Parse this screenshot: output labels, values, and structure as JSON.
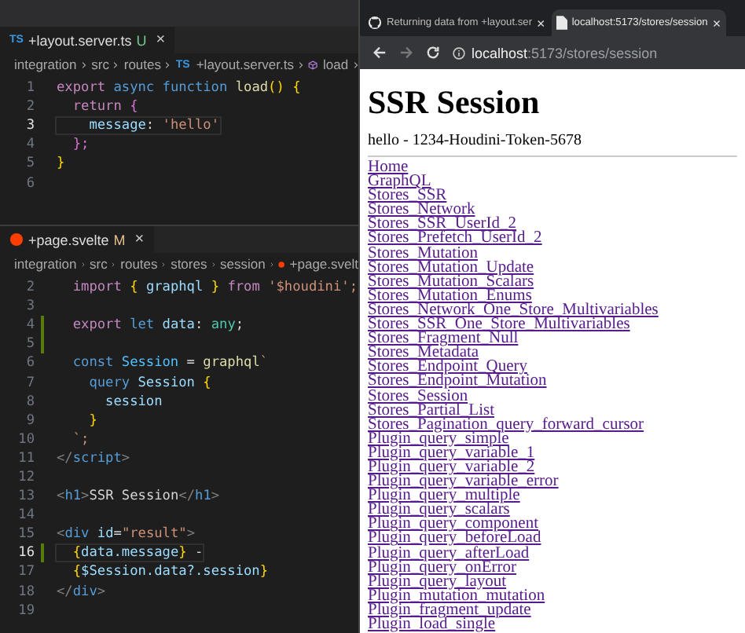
{
  "editor": {
    "panes": [
      {
        "tab": {
          "badge": "TS",
          "filename": "+layout.server.ts",
          "status": "U",
          "close": "×"
        },
        "breadcrumb": [
          {
            "kind": "text",
            "label": "integration"
          },
          {
            "kind": "text",
            "label": "src"
          },
          {
            "kind": "text",
            "label": "routes"
          },
          {
            "kind": "ts",
            "badge": "TS",
            "label": "+layout.server.ts"
          },
          {
            "kind": "symbol",
            "label": "load"
          }
        ],
        "trailing_chevron": true,
        "lines": [
          {
            "number": "1",
            "current": false,
            "changed": false,
            "tokens": [
              {
                "text": "export ",
                "kind": "kw"
              },
              {
                "text": "async ",
                "kind": "kw2"
              },
              {
                "text": "function ",
                "kind": "kw2"
              },
              {
                "text": "load",
                "kind": "fn"
              },
              {
                "text": "() {",
                "kind": "brace"
              }
            ]
          },
          {
            "number": "2",
            "current": false,
            "changed": false,
            "tokens": [
              {
                "text": "  return ",
                "kind": "kw"
              },
              {
                "text": "{",
                "kind": "brace2"
              }
            ]
          },
          {
            "number": "3",
            "current": true,
            "changed": false,
            "tokens": [
              {
                "text": "    message",
                "kind": "prop"
              },
              {
                "text": ": ",
                "kind": "txt"
              },
              {
                "text": "'hello'",
                "kind": "str"
              }
            ]
          },
          {
            "number": "4",
            "current": false,
            "changed": false,
            "tokens": [
              {
                "text": "  };",
                "kind": "brace2"
              }
            ]
          },
          {
            "number": "5",
            "current": false,
            "changed": false,
            "tokens": [
              {
                "text": "}",
                "kind": "brace"
              }
            ]
          },
          {
            "number": "6",
            "current": false,
            "changed": false
          }
        ]
      },
      {
        "tab": {
          "filename": "+page.svelte",
          "status": "M",
          "close": "×"
        },
        "breadcrumb": [
          {
            "kind": "text",
            "label": "integration"
          },
          {
            "kind": "text",
            "label": "src"
          },
          {
            "kind": "text",
            "label": "routes"
          },
          {
            "kind": "text",
            "label": "stores"
          },
          {
            "kind": "text",
            "label": "session"
          },
          {
            "kind": "svelte",
            "label": "+page.svelt"
          }
        ],
        "trailing_chevron": false,
        "lines": [
          {
            "number": "2",
            "current": false,
            "changed": false,
            "tokens": [
              {
                "text": "  import ",
                "kind": "kw"
              },
              {
                "text": "{",
                "kind": "brace"
              },
              {
                "text": " graphql ",
                "kind": "prop"
              },
              {
                "text": "} ",
                "kind": "brace"
              },
              {
                "text": "from ",
                "kind": "kw"
              },
              {
                "text": "'$houdini';",
                "kind": "str"
              }
            ]
          },
          {
            "number": "3",
            "current": false,
            "changed": false
          },
          {
            "number": "4",
            "current": false,
            "changed": true,
            "tokens": [
              {
                "text": "  export ",
                "kind": "kw"
              },
              {
                "text": "let",
                "kind": "kw2"
              },
              {
                "text": " data",
                "kind": "prop"
              },
              {
                "text": ": ",
                "kind": "txt"
              },
              {
                "text": "any",
                "kind": "type"
              },
              {
                "text": ";",
                "kind": "txt"
              }
            ]
          },
          {
            "number": "5",
            "current": false,
            "changed": true
          },
          {
            "number": "6",
            "current": false,
            "changed": false,
            "tokens": [
              {
                "text": "  const",
                "kind": "kw2"
              },
              {
                "text": " Session",
                "kind": "var"
              },
              {
                "text": " = ",
                "kind": "txt"
              },
              {
                "text": "graphql",
                "kind": "fn"
              },
              {
                "text": "`",
                "kind": "str"
              }
            ]
          },
          {
            "number": "7",
            "current": false,
            "changed": false,
            "tokens": [
              {
                "text": "    query",
                "kind": "kw2"
              },
              {
                "text": " Session ",
                "kind": "prop"
              },
              {
                "text": "{",
                "kind": "brace"
              }
            ]
          },
          {
            "number": "8",
            "current": false,
            "changed": false,
            "tokens": [
              {
                "text": "      session",
                "kind": "prop"
              }
            ]
          },
          {
            "number": "9",
            "current": false,
            "changed": false,
            "tokens": [
              {
                "text": "    }",
                "kind": "brace"
              }
            ]
          },
          {
            "number": "10",
            "current": false,
            "changed": false,
            "tokens": [
              {
                "text": "  `;",
                "kind": "str"
              }
            ]
          },
          {
            "number": "11",
            "current": false,
            "changed": false,
            "tokens": [
              {
                "text": "</",
                "kind": "tag"
              },
              {
                "text": "script",
                "kind": "tagname"
              },
              {
                "text": ">",
                "kind": "tag"
              }
            ]
          },
          {
            "number": "12",
            "current": false,
            "changed": false
          },
          {
            "number": "13",
            "current": false,
            "changed": false,
            "tokens": [
              {
                "text": "<",
                "kind": "tag"
              },
              {
                "text": "h1",
                "kind": "tagname"
              },
              {
                "text": ">",
                "kind": "tag"
              },
              {
                "text": "SSR Session",
                "kind": "txt"
              },
              {
                "text": "</",
                "kind": "tag"
              },
              {
                "text": "h1",
                "kind": "tagname"
              },
              {
                "text": ">",
                "kind": "tag"
              }
            ]
          },
          {
            "number": "14",
            "current": false,
            "changed": false
          },
          {
            "number": "15",
            "current": false,
            "changed": false,
            "tokens": [
              {
                "text": "<",
                "kind": "tag"
              },
              {
                "text": "div",
                "kind": "tagname"
              },
              {
                "text": " id",
                "kind": "prop"
              },
              {
                "text": "=",
                "kind": "txt"
              },
              {
                "text": "\"result\"",
                "kind": "str"
              },
              {
                "text": ">",
                "kind": "tag"
              }
            ]
          },
          {
            "number": "16",
            "current": true,
            "changed": true,
            "tokens": [
              {
                "text": "  {",
                "kind": "brace"
              },
              {
                "text": "data.message",
                "kind": "prop"
              },
              {
                "text": "}",
                "kind": "brace"
              },
              {
                "text": " -",
                "kind": "txt"
              }
            ]
          },
          {
            "number": "17",
            "current": false,
            "changed": false,
            "tokens": [
              {
                "text": "  {",
                "kind": "brace"
              },
              {
                "text": "$Session.data?.session",
                "kind": "prop"
              },
              {
                "text": "}",
                "kind": "brace"
              }
            ]
          },
          {
            "number": "18",
            "current": false,
            "changed": false,
            "tokens": [
              {
                "text": "</",
                "kind": "tag"
              },
              {
                "text": "div",
                "kind": "tagname"
              },
              {
                "text": ">",
                "kind": "tag"
              }
            ]
          },
          {
            "number": "19",
            "current": false,
            "changed": false
          }
        ]
      }
    ]
  },
  "browser": {
    "tabs": [
      {
        "kind": "github",
        "title": "Returning data from +layout.ser",
        "close": "×",
        "selected": false
      },
      {
        "kind": "page",
        "title": "localhost:5173/stores/session",
        "close": "×",
        "selected": true
      }
    ],
    "address": {
      "host": "localhost",
      "path": ":5173/stores/session"
    },
    "page": {
      "heading": "SSR Session",
      "result": "hello - 1234-Houdini-Token-5678",
      "links": [
        "Home",
        "GraphQL",
        "Stores_SSR",
        "Stores_Network",
        "Stores_SSR_UserId_2",
        "Stores_Prefetch_UserId_2",
        "Stores_Mutation",
        "Stores_Mutation_Update",
        "Stores_Mutation_Scalars",
        "Stores_Mutation_Enums",
        "Stores_Network_One_Store_Multivariables",
        "Stores_SSR_One_Store_Multivariables",
        "Stores_Fragment_Null",
        "Stores_Metadata",
        "Stores_Endpoint_Query",
        "Stores_Endpoint_Mutation",
        "Stores_Session",
        "Stores_Partial_List",
        "Stores_Pagination_query_forward_cursor",
        "Plugin_query_simple",
        "Plugin_query_variable_1",
        "Plugin_query_variable_2",
        "Plugin_query_variable_error",
        "Plugin_query_multiple",
        "Plugin_query_scalars",
        "Plugin_query_component",
        "Plugin_query_beforeLoad",
        "Plugin_query_afterLoad",
        "Plugin_query_onError",
        "Plugin_query_layout",
        "Plugin_mutation_mutation",
        "Plugin_fragment_update",
        "Plugin_load_single"
      ]
    }
  }
}
